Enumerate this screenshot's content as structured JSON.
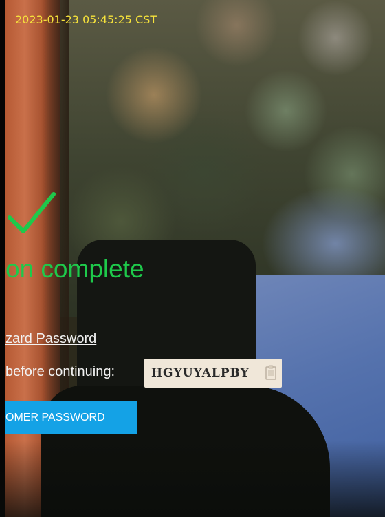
{
  "overlay": {
    "timestamp": "2023-01-23 05:45:25 CST"
  },
  "screen": {
    "status_title": "on complete",
    "password_link": "zard Password",
    "instruction": "before continuing:",
    "code": "HGYUYALPBY",
    "button_label": "OMER PASSWORD"
  },
  "icons": {
    "status": "check-icon",
    "copy": "clipboard-icon"
  },
  "colors": {
    "timestamp": "#f6e23b",
    "success_green": "#1ec94b",
    "button_blue": "#14a2e6",
    "code_background": "#f0e7d9"
  }
}
